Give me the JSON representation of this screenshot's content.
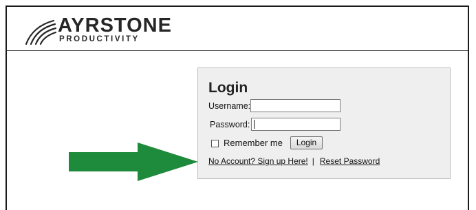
{
  "brand": {
    "name": "AYRSTONE",
    "tagline": "PRODUCTIVITY"
  },
  "login": {
    "title": "Login",
    "username_label": "Username:",
    "username_value": "",
    "password_label": "Password:",
    "password_value": "",
    "remember_label": "Remember me",
    "remember_checked": false,
    "button_label": "Login",
    "signup_link": "No Account? Sign up Here!",
    "separator": "|",
    "reset_link": "Reset Password"
  },
  "annotation": {
    "arrow_color": "#1e8a3c"
  }
}
